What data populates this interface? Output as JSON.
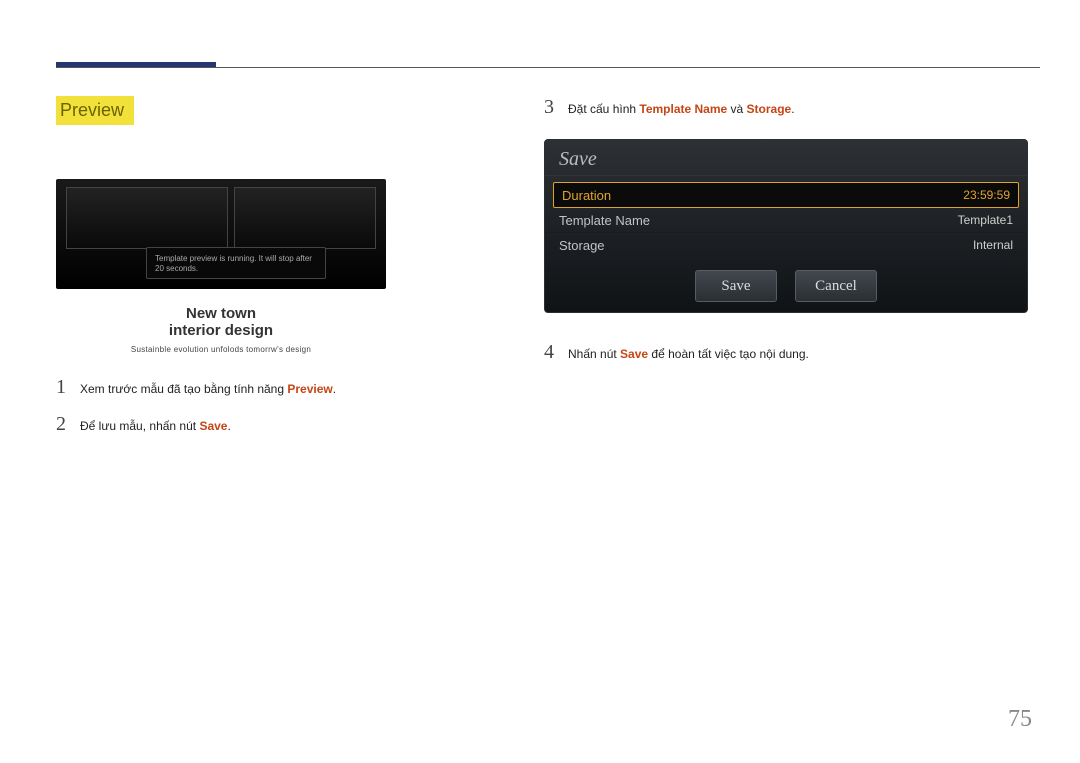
{
  "preview_label": "Preview",
  "preview_message": "Template preview is running. It will stop after 20 seconds.",
  "preview_caption": {
    "line1": "New town",
    "line2": "interior design",
    "sub": "Sustainble evolution unfolods tomorrw's design"
  },
  "steps_left": [
    {
      "num": "1",
      "pre": "Xem trước mẫu đã tạo bằng tính năng ",
      "kw": "Preview",
      "post": "."
    },
    {
      "num": "2",
      "pre": "Để lưu mẫu, nhấn nút ",
      "kw": "Save",
      "post": "."
    }
  ],
  "steps_right": [
    {
      "num": "3",
      "pre": "Đặt cấu hình ",
      "kw": "Template Name",
      "mid": " và ",
      "kw2": "Storage",
      "post": "."
    },
    {
      "num": "4",
      "pre": "Nhấn nút ",
      "kw": "Save",
      "post": " để hoàn tất việc tạo nội dung."
    }
  ],
  "save_dialog": {
    "title": "Save",
    "rows": [
      {
        "label": "Duration",
        "value": "23:59:59",
        "highlight": true
      },
      {
        "label": "Template Name",
        "value": "Template1",
        "highlight": false
      },
      {
        "label": "Storage",
        "value": "Internal",
        "highlight": false
      }
    ],
    "save_btn": "Save",
    "cancel_btn": "Cancel"
  },
  "page_number": "75"
}
